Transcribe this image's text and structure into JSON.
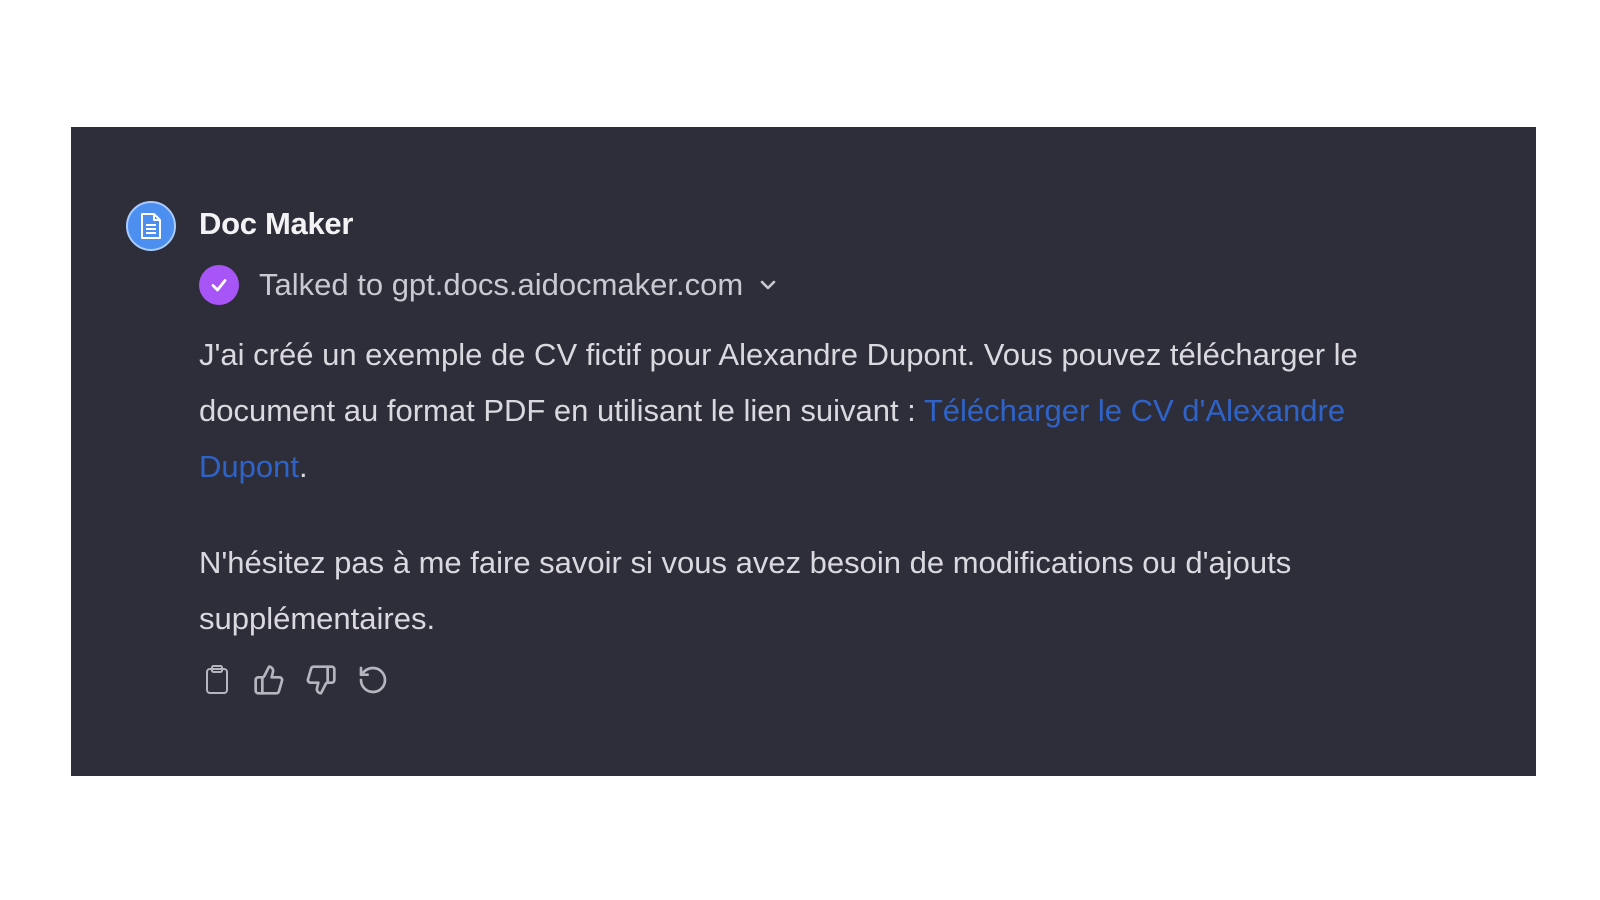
{
  "message": {
    "author": "Doc Maker",
    "avatar_icon": "document-icon",
    "tool_call": {
      "label": "Talked to gpt.docs.aidocmaker.com",
      "status_icon": "check-circle-icon",
      "expand_icon": "chevron-down-icon"
    },
    "paragraph_1": {
      "text": "J'ai créé un exemple de CV fictif pour Alexandre Dupont. Vous pouvez télécharger le document au format PDF en utilisant le lien suivant : ",
      "link_text": "Télécharger le CV d'Alexandre Dupont",
      "after_link": "."
    },
    "paragraph_2": "N'hésitez pas à me faire savoir si vous avez besoin de modifications ou d'ajouts supplémentaires.",
    "actions": [
      {
        "name": "copy",
        "icon": "clipboard-icon"
      },
      {
        "name": "thumbs-up",
        "icon": "thumbs-up-icon"
      },
      {
        "name": "thumbs-down",
        "icon": "thumbs-down-icon"
      },
      {
        "name": "regenerate",
        "icon": "refresh-icon"
      }
    ]
  },
  "colors": {
    "panel_background": "#2e2e3a",
    "avatar": "#4d8ff0",
    "check_badge": "#a855f7",
    "link": "#2f63c8"
  }
}
